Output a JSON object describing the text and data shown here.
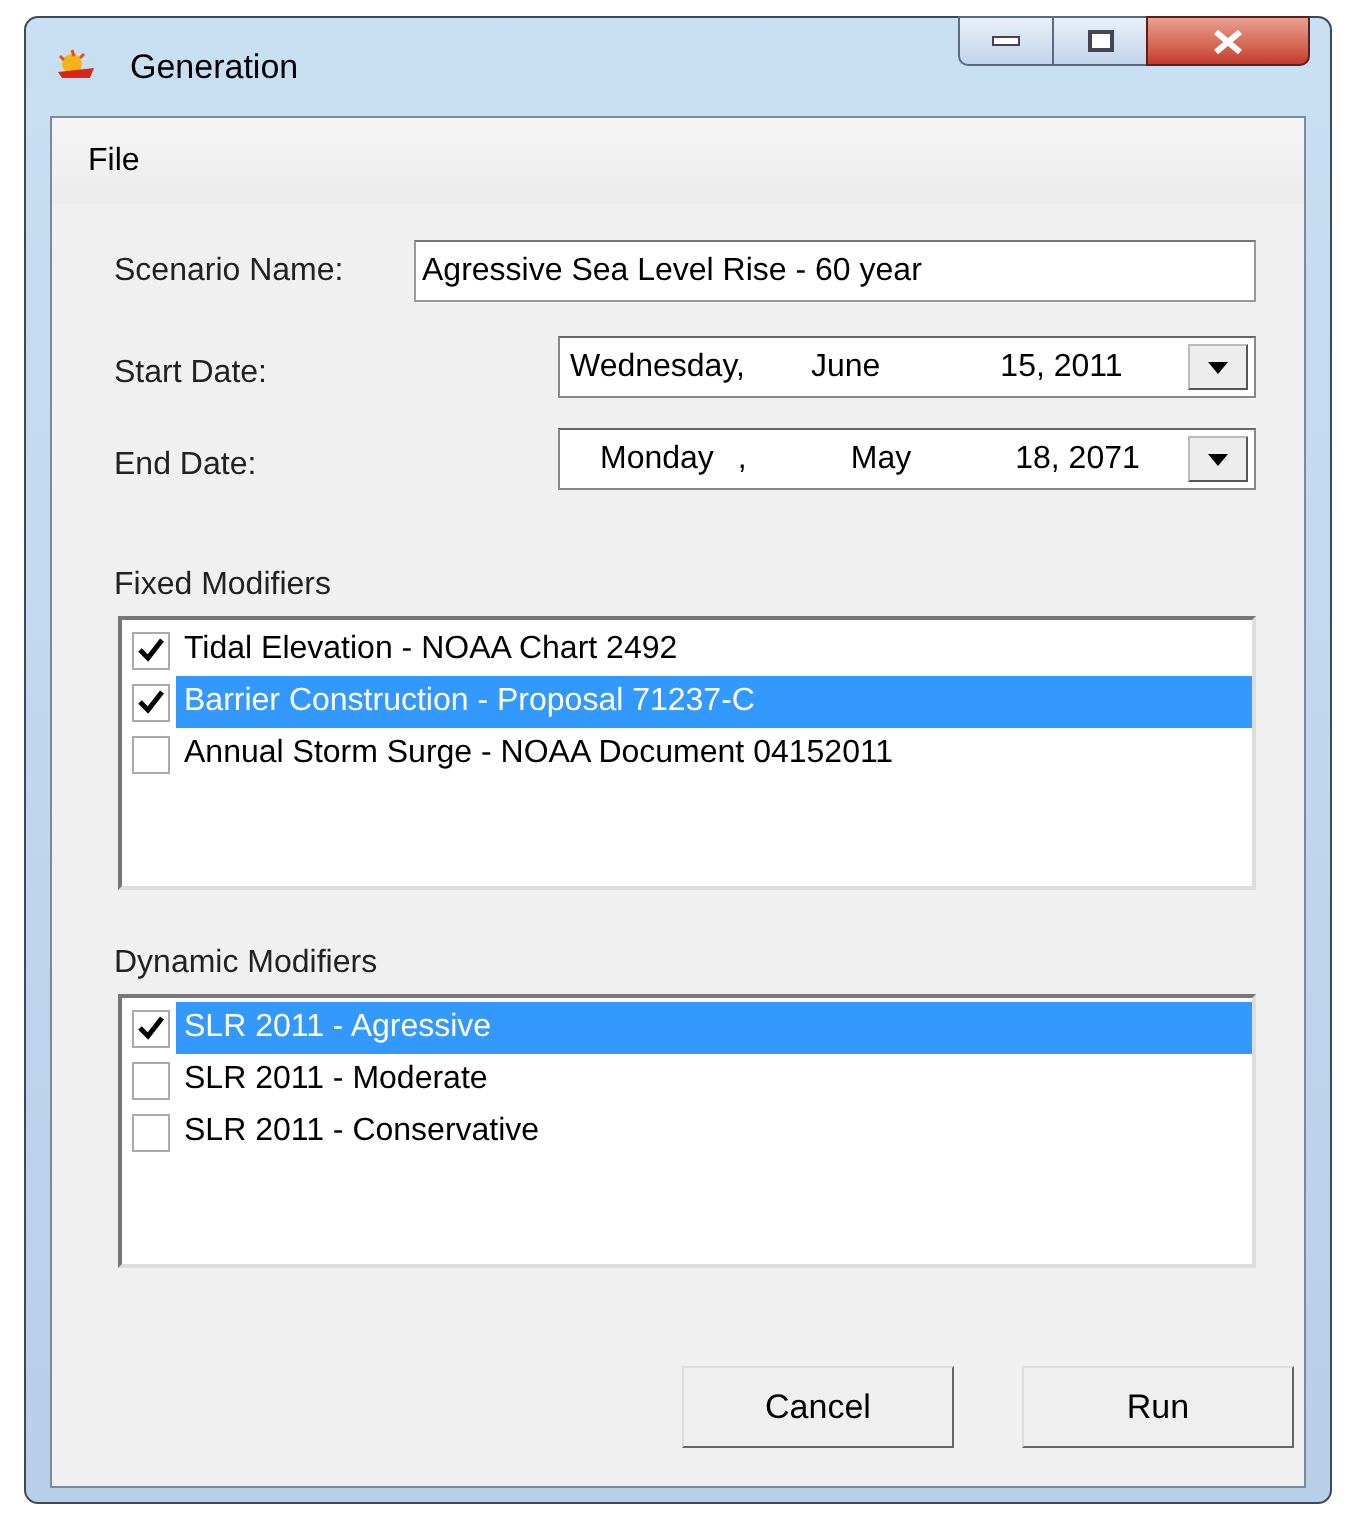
{
  "window": {
    "title": "Generation"
  },
  "menu": [
    "File"
  ],
  "scenario": {
    "label": "Scenario Name:",
    "value": "Agressive Sea Level Rise - 60 year"
  },
  "dates": [
    {
      "label": "Start Date:",
      "parts": [
        "Wednesday,",
        "June",
        "15, 2011"
      ]
    },
    {
      "label": "End Date:",
      "parts": [
        "Monday",
        ",",
        "May",
        "18, 2071"
      ]
    }
  ],
  "lists": [
    {
      "title": "Fixed Modifiers",
      "items": [
        {
          "label": "Tidal Elevation - NOAA Chart 2492",
          "checked": true,
          "selected": false
        },
        {
          "label": "Barrier Construction - Proposal 71237-C",
          "checked": true,
          "selected": true
        },
        {
          "label": "Annual Storm Surge - NOAA Document 04152011",
          "checked": false,
          "selected": false
        }
      ]
    },
    {
      "title": "Dynamic Modifiers",
      "items": [
        {
          "label": "SLR 2011 - Agressive",
          "checked": true,
          "selected": true
        },
        {
          "label": "SLR 2011 - Moderate",
          "checked": false,
          "selected": false
        },
        {
          "label": "SLR 2011 - Conservative",
          "checked": false,
          "selected": false
        }
      ]
    }
  ],
  "buttons": [
    "Cancel",
    "Run"
  ]
}
